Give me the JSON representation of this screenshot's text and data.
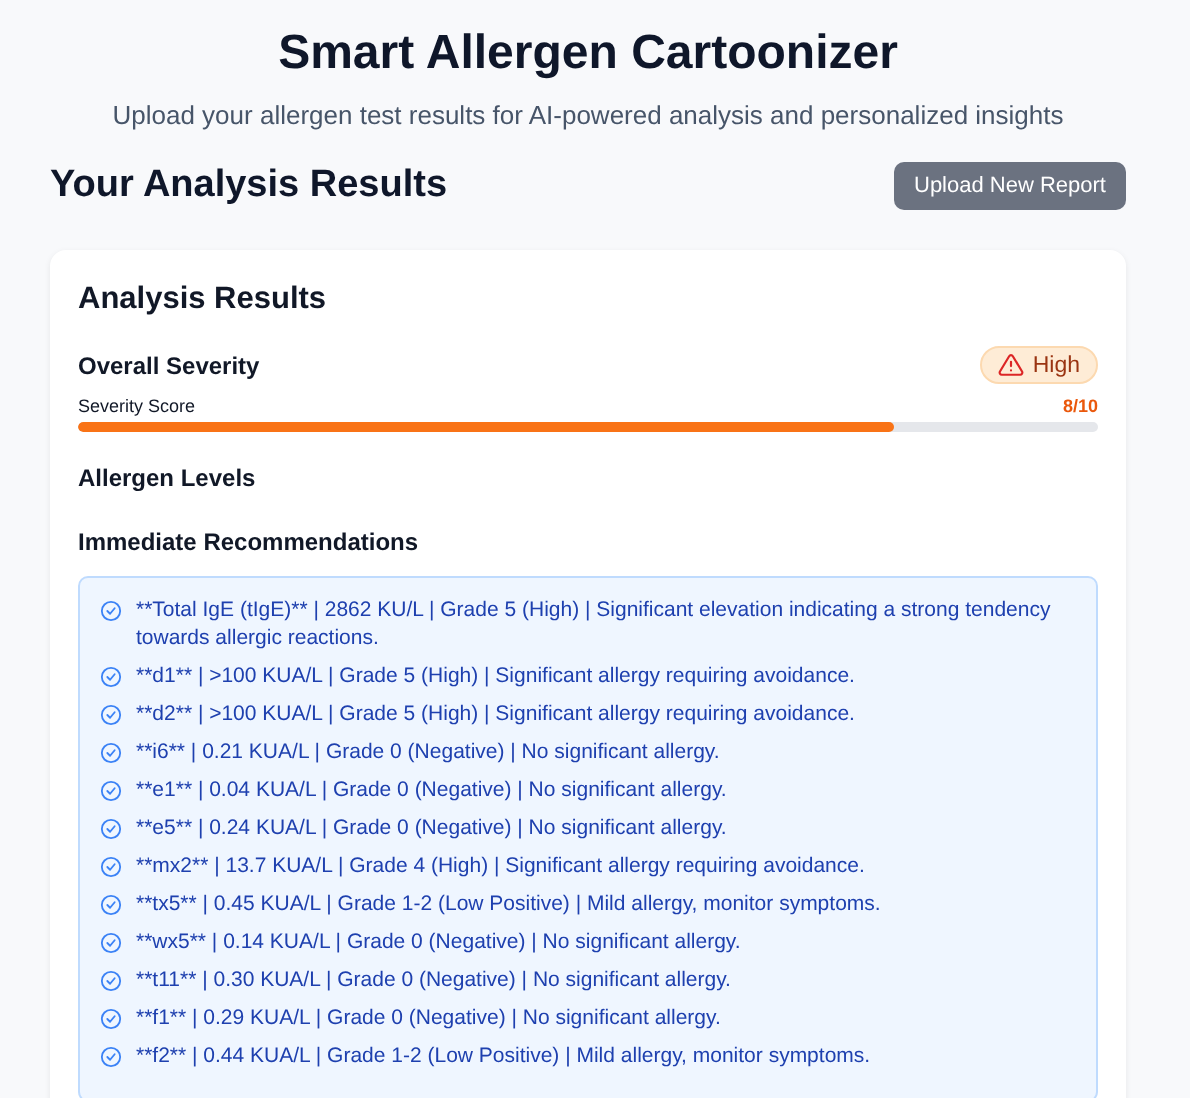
{
  "header": {
    "title": "Smart Allergen Cartoonizer",
    "subtitle": "Upload your allergen test results for AI-powered analysis and personalized insights"
  },
  "section": {
    "title": "Your Analysis Results",
    "button": "Upload New Report"
  },
  "card": {
    "title": "Analysis Results",
    "severity_label": "Overall Severity",
    "badge": {
      "text": "High"
    },
    "score": {
      "label": "Severity Score",
      "reading": "8/10",
      "level": 0.8
    },
    "allergen_levels": "Allergen Levels",
    "recommendations_title": "Immediate Recommendations",
    "recommendations": [
      "**Total IgE (tIgE)** | 2862 KU/L | Grade 5 (High) | Significant elevation indicating a strong tendency towards allergic reactions.",
      "**d1** | >100 KUA/L | Grade 5 (High) | Significant allergy requiring avoidance.",
      "**d2** | >100 KUA/L | Grade 5 (High) | Significant allergy requiring avoidance.",
      "**i6** | 0.21 KUA/L | Grade 0 (Negative) | No significant allergy.",
      "**e1** | 0.04 KUA/L | Grade 0 (Negative) | No significant allergy.",
      "**e5** | 0.24 KUA/L | Grade 0 (Negative) | No significant allergy.",
      "**mx2** | 13.7 KUA/L | Grade 4 (High) | Significant allergy requiring avoidance.",
      "**tx5** | 0.45 KUA/L | Grade 1-2 (Low Positive) | Mild allergy, monitor symptoms.",
      "**wx5** | 0.14 KUA/L | Grade 0 (Negative) | No significant allergy.",
      "**t11** | 0.30 KUA/L | Grade 0 (Negative) | No significant allergy.",
      "**f1** | 0.29 KUA/L | Grade 0 (Negative) | No significant allergy.",
      "**f2** | 0.44 KUA/L | Grade 1-2 (Low Positive) | Mild allergy, monitor symptoms."
    ]
  }
}
